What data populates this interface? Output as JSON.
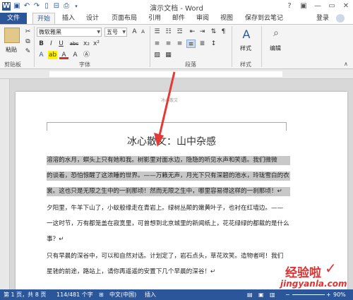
{
  "window": {
    "title": "演示文档 - Word",
    "help": "?",
    "minimize": "—",
    "restore": "▭",
    "close": "✕"
  },
  "quick_access": {
    "icons": [
      "word-logo",
      "save-icon",
      "undo-icon",
      "redo-icon",
      "new-doc-icon",
      "open-icon",
      "print-icon"
    ]
  },
  "tabs": {
    "file": "文件",
    "items": [
      "开始",
      "插入",
      "设计",
      "页面布局",
      "引用",
      "邮件",
      "审阅",
      "视图",
      "保存到云笔记"
    ],
    "active": "开始",
    "login": "登录"
  },
  "ribbon": {
    "clipboard": {
      "paste": "粘贴",
      "label": "剪贴板"
    },
    "font": {
      "name": "微软雅黑",
      "size": "五号",
      "bold": "B",
      "italic": "I",
      "underline": "U",
      "strike": "abc",
      "sub": "x₂",
      "sup": "x²",
      "font_color_letter": "A",
      "label": "字体"
    },
    "paragraph": {
      "label": "段落"
    },
    "styles": {
      "button": "样式",
      "label": "样式"
    },
    "editing": {
      "button": "编辑"
    }
  },
  "document": {
    "header": "冰心散文",
    "title": "冰心散文：山中杂感",
    "lines": [
      {
        "text": "溶溶的水月，螟头上只有她和我。树影里对面水边，隐隐的听见水声和笑语。我们微微",
        "highlight": true
      },
      {
        "text": "的谈着，恐怕惊醒了这浓睡的世界。——万籁无声，月光下只有深碧的池水，玲珑雪白的衣",
        "highlight": true
      },
      {
        "text": "裳。这也只是无限之生中的一刹那顷！然而无限之生中，哪里容易得这样的一刹那顷！↵",
        "highlight": true
      },
      {
        "text": "    夕阳里，牛羊下山了，小蚁般缘走在青岩上。绿树丛颠的嫩黄叶子，也衬在红墙边。——",
        "highlight": false
      },
      {
        "text": "一这时节，万有都笼盖在寂寞里，可曾想到北京城里的新闻纸上，花花绿绿的都载的是什么",
        "highlight": false
      },
      {
        "text": "事？↵",
        "highlight": false
      },
      {
        "text": "    只有早晨的深谷中，可以和自然对话。计划定了，岩石点头，草花欢笑。造物者呵！我们",
        "highlight": false
      },
      {
        "text": "星驰的前途，路站上，请你再遥遥的安置下几个早晨的深谷！↵",
        "highlight": false
      }
    ]
  },
  "status": {
    "page": "第 1 页，共 8 页",
    "words": "114/481 个字",
    "lang": "中文(中国)",
    "mode": "插入",
    "zoom": "90%"
  },
  "watermark": {
    "line1": "经验啦",
    "line2": "jingyanla.com"
  },
  "colors": {
    "accent": "#2b579a",
    "highlight": "#c8c8c8",
    "arrow": "#e53935"
  }
}
